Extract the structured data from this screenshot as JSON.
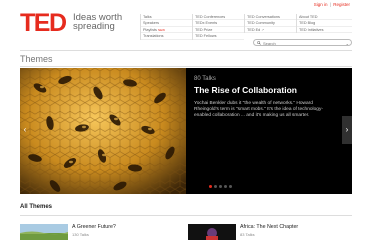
{
  "header": {
    "sign_in": "Sign in",
    "separator": "|",
    "register": "Register",
    "logo": "TED",
    "tagline": "Ideas worth spreading"
  },
  "nav": {
    "col1": [
      {
        "label": "Talks"
      },
      {
        "label": "Speakers"
      },
      {
        "label": "Playlists",
        "badge": "NEW"
      },
      {
        "label": "Translations"
      }
    ],
    "col2": [
      "TED Conferences",
      "TEDx Events",
      "TED Prize",
      "TED Fellows"
    ],
    "col3": [
      "TED Conversations",
      "TED Community",
      "TED Ed"
    ],
    "col4": [
      "About TED",
      "TED Blog",
      "TED Initiatives"
    ]
  },
  "search": {
    "placeholder": "Search"
  },
  "page": {
    "title": "Themes"
  },
  "hero": {
    "count": "80 Talks",
    "title": "The Rise of Collaboration",
    "description": "Yochai Benkler dubs it \"the wealth of networks.\" Howard Rheingold's term is \"smart mobs.\" It's the idea of technology-enabled collaboration ... and it's making us all smarter.",
    "prev_label": "‹",
    "next_label": "›",
    "slide_count": 5
  },
  "all_themes": {
    "heading": "All Themes",
    "items": [
      {
        "title": "A Greener Future?",
        "count": "130 Talks"
      },
      {
        "title": "Africa: The Next Chapter",
        "count": "83 Talks"
      }
    ]
  },
  "colors": {
    "brand": "#e62b1e"
  }
}
